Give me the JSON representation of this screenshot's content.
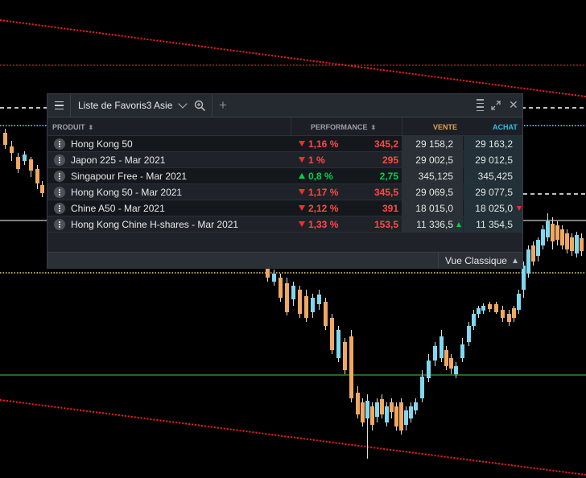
{
  "colors": {
    "up": "#00d14a",
    "down": "#ff2a2a",
    "down_text": "#ff4848",
    "vente_header": "#e0a050",
    "achat_header": "#38b8e8"
  },
  "widget": {
    "menu_icon": "hamburger-icon",
    "title": "Liste de Favoris3 Asie",
    "search_icon": "zoom-icon",
    "add_icon": "+",
    "close_icon": "✕"
  },
  "table": {
    "headers": {
      "product": "PRODUIT",
      "performance": "PERFORMANCE",
      "vente": "VENTE",
      "achat": "ACHAT"
    },
    "rows": [
      {
        "name": "Hong Kong 50",
        "direction": "down",
        "perf": "1,16 %",
        "change": "345,2",
        "sell": "29 158,2",
        "buy": "29 163,2",
        "tick": ""
      },
      {
        "name": "Japon 225 - Mar 2021",
        "direction": "down",
        "perf": "1 %",
        "change": "295",
        "sell": "29 002,5",
        "buy": "29 012,5",
        "tick": ""
      },
      {
        "name": "Singapour Free - Mar 2021",
        "direction": "up",
        "perf": "0,8 %",
        "change": "2,75",
        "sell": "345,125",
        "buy": "345,425",
        "tick": ""
      },
      {
        "name": "Hong Kong 50 - Mar 2021",
        "direction": "down",
        "perf": "1,17 %",
        "change": "345,5",
        "sell": "29 069,5",
        "buy": "29 077,5",
        "tick": ""
      },
      {
        "name": "Chine A50 - Mar 2021",
        "direction": "down",
        "perf": "2,12 %",
        "change": "391",
        "sell": "18 015,0",
        "buy": "18 025,0",
        "tick": "down"
      },
      {
        "name": "Hong Kong Chine H-shares - Mar 2021",
        "direction": "down",
        "perf": "1,33 %",
        "change": "153,5",
        "sell": "11 336,5",
        "buy": "11 354,5",
        "tick": "up"
      }
    ]
  },
  "footer": {
    "view_label": "Vue Classique"
  }
}
